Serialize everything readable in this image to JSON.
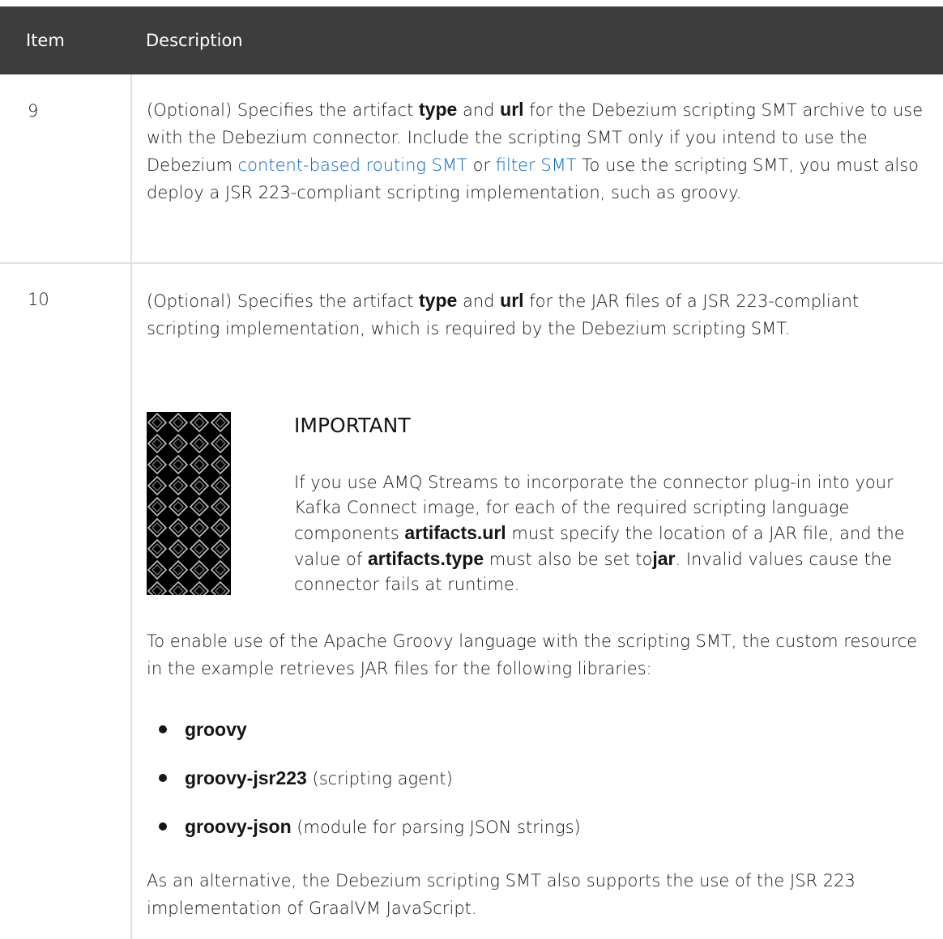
{
  "table": {
    "headers": {
      "item": "Item",
      "description": "Description"
    },
    "rows": [
      {
        "item": "9",
        "desc": {
          "t1": "(Optional) Specifies the artifact ",
          "b1": "type",
          "t2": " and ",
          "b2": "url",
          "t3": " for the Debezium scripting SMT archive to use with the Debezium connector. Include the scripting SMT only if you intend to use the Debezium ",
          "link1": "content-based routing SMT",
          "t4": " or ",
          "link2": "filter SMT",
          "t5": " To use the scripting SMT, you must also deploy a JSR 223-compliant scripting implementation, such as groovy."
        }
      },
      {
        "item": "10",
        "desc": {
          "t1": "(Optional) Specifies the artifact ",
          "b1": "type",
          "t2": " and ",
          "b2": "url",
          "t3": " for the JAR files of a JSR 223-compliant scripting implementation, which is required by the Debezium scripting SMT."
        },
        "admonition": {
          "title": "IMPORTANT",
          "t1": "If you use AMQ Streams to incorporate the connector plug-in into your Kafka Connect image, for each of the required scripting language components ",
          "b1": "artifacts.url",
          "t2": " must specify the location of a JAR file, and the value of ",
          "b2": "artifacts.type",
          "t3": " must also be set to",
          "b3": "jar",
          "t4": ". Invalid values cause the connector fails at runtime."
        },
        "para2": "To enable use of the Apache Groovy language with the scripting SMT, the custom resource in the example retrieves JAR files for the following libraries:",
        "libraries": [
          {
            "name": "groovy",
            "note": ""
          },
          {
            "name": "groovy-jsr223",
            "note": " (scripting agent)"
          },
          {
            "name": "groovy-json",
            "note": " (module for parsing JSON strings)"
          }
        ],
        "para3": "As an alternative, the Debezium scripting SMT also supports the use of the JSR 223 implementation of GraalVM JavaScript."
      }
    ]
  }
}
